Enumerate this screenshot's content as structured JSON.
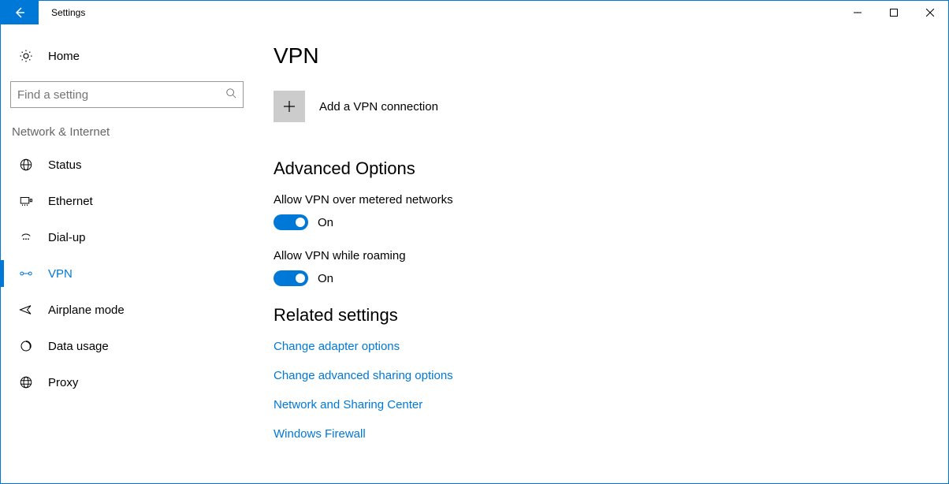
{
  "window": {
    "title": "Settings"
  },
  "sidebar": {
    "home": "Home",
    "search_placeholder": "Find a setting",
    "category": "Network & Internet",
    "items": [
      {
        "icon": "status",
        "label": "Status"
      },
      {
        "icon": "ethernet",
        "label": "Ethernet"
      },
      {
        "icon": "dialup",
        "label": "Dial-up"
      },
      {
        "icon": "vpn",
        "label": "VPN"
      },
      {
        "icon": "airplane",
        "label": "Airplane mode"
      },
      {
        "icon": "data",
        "label": "Data usage"
      },
      {
        "icon": "proxy",
        "label": "Proxy"
      }
    ],
    "selected_index": 3
  },
  "main": {
    "title": "VPN",
    "add_label": "Add a VPN connection",
    "advanced_heading": "Advanced Options",
    "option_metered": {
      "label": "Allow VPN over metered networks",
      "state": "On"
    },
    "option_roaming": {
      "label": "Allow VPN while roaming",
      "state": "On"
    },
    "related_heading": "Related settings",
    "links": [
      "Change adapter options",
      "Change advanced sharing options",
      "Network and Sharing Center",
      "Windows Firewall"
    ]
  }
}
